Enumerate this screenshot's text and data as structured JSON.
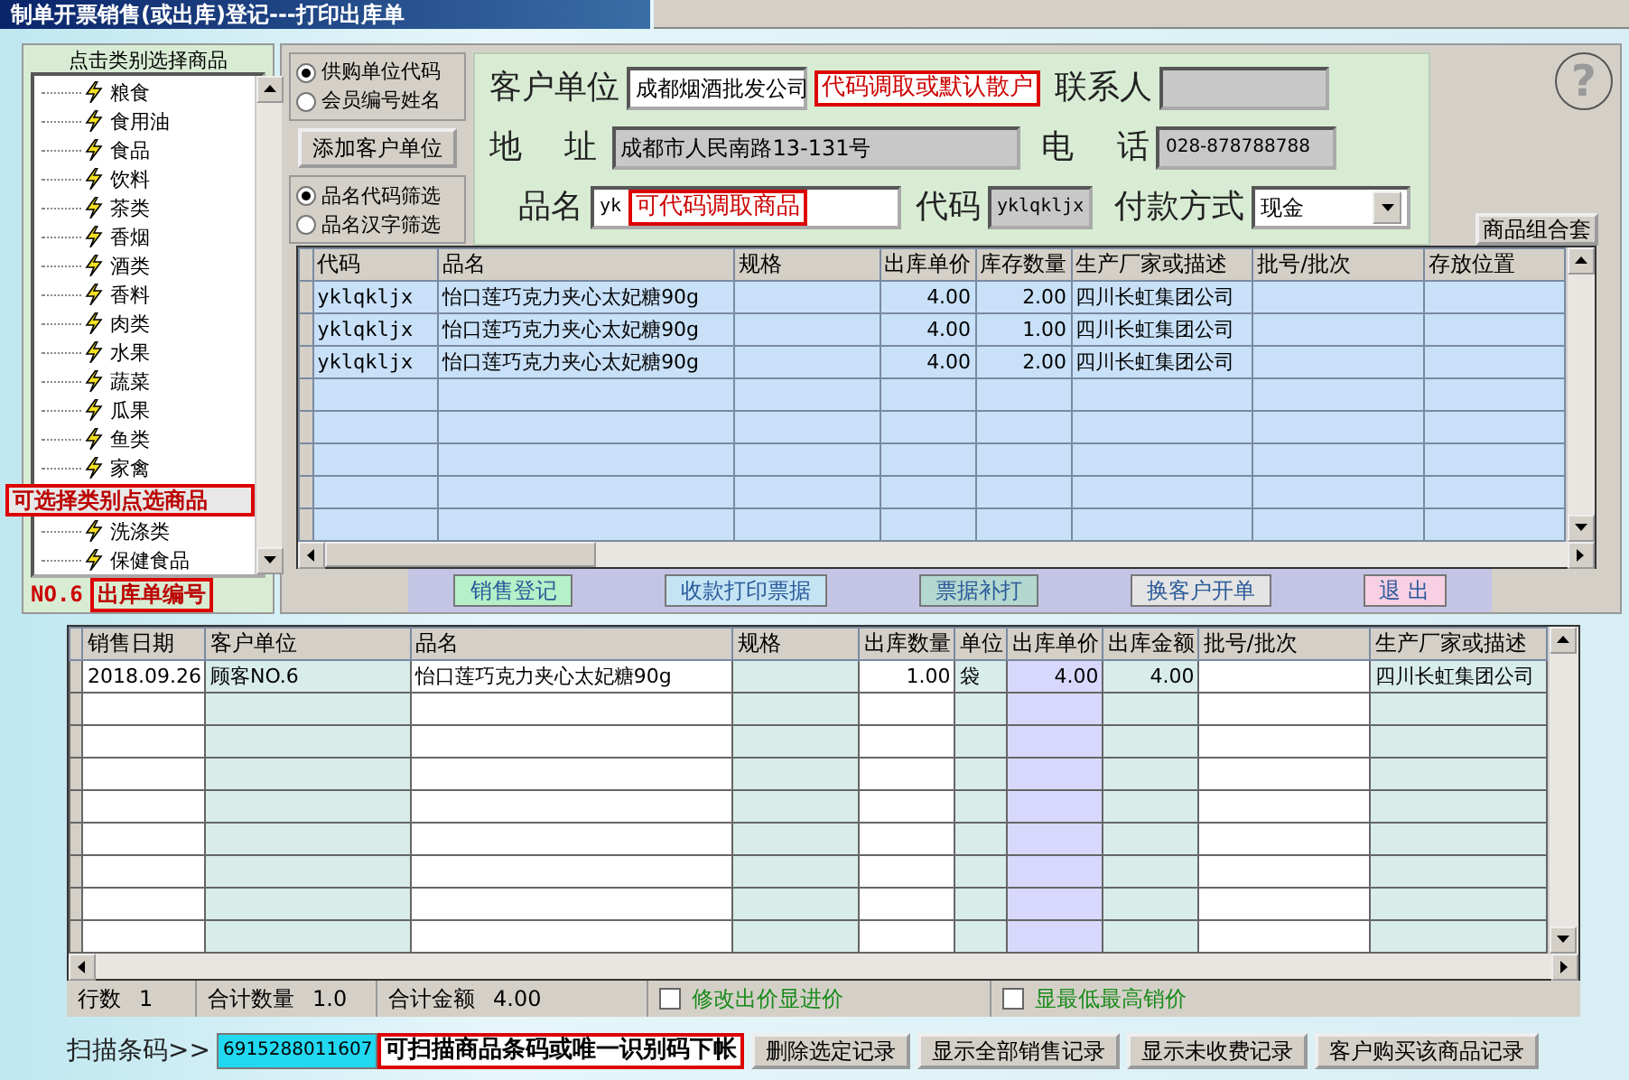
{
  "window": {
    "title": "制单开票销售(或出库)登记---打印出库单"
  },
  "category_panel": {
    "heading": "点击类别选择商品",
    "items": [
      {
        "label": "粮食"
      },
      {
        "label": "食用油"
      },
      {
        "label": "食品"
      },
      {
        "label": "饮料"
      },
      {
        "label": "茶类"
      },
      {
        "label": "香烟"
      },
      {
        "label": "酒类"
      },
      {
        "label": "香料"
      },
      {
        "label": "肉类"
      },
      {
        "label": "水果"
      },
      {
        "label": "蔬菜"
      },
      {
        "label": "瓜果"
      },
      {
        "label": "鱼类"
      },
      {
        "label": "家禽"
      }
    ],
    "overlay_note": "可选择类别点选商品",
    "more_items": [
      {
        "label": "洗涤类"
      },
      {
        "label": "保健食品"
      }
    ],
    "order_no": "NO.6",
    "order_note": "出库单编号"
  },
  "customer_mode": [
    {
      "label": "供购单位代码",
      "selected": true
    },
    {
      "label": "会员编号姓名",
      "selected": false
    }
  ],
  "add_customer_button": "添加客户单位",
  "filter_mode": [
    {
      "label": "品名代码筛选",
      "selected": true
    },
    {
      "label": "品名汉字筛选",
      "selected": false
    }
  ],
  "form": {
    "customer_label": "客户单位",
    "customer_value": "成都烟酒批发公司",
    "customer_note": "代码调取或默认散户",
    "contact_label": "联系人",
    "address_label": "地 址",
    "address_value": "成都市人民南路13-131号",
    "phone_label": "电 话",
    "phone_value": "028-878788788",
    "product_label": "品名",
    "product_value": "yk",
    "product_note": "可代码调取商品",
    "code_label": "代码",
    "code_value": "yklqkljx",
    "payment_label": "付款方式",
    "payment_value": "现金"
  },
  "help_button": "?",
  "combo_button": "商品组合套",
  "product_grid": {
    "columns": [
      "代码",
      "品名",
      "规格",
      "出库单价",
      "库存数量",
      "生产厂家或描述",
      "批号/批次",
      "存放位置"
    ],
    "rows": [
      [
        "yklqkljx",
        "怡口莲巧克力夹心太妃糖90g",
        "",
        "4.00",
        "2.00",
        "四川长虹集团公司",
        "",
        ""
      ],
      [
        "yklqkljx",
        "怡口莲巧克力夹心太妃糖90g",
        "",
        "4.00",
        "1.00",
        "四川长虹集团公司",
        "",
        ""
      ],
      [
        "yklqkljx",
        "怡口莲巧克力夹心太妃糖90g",
        "",
        "4.00",
        "2.00",
        "四川长虹集团公司",
        "",
        ""
      ]
    ]
  },
  "action_buttons": [
    {
      "label": "销售登记",
      "color": "#b4f0c8"
    },
    {
      "label": "收款打印票据",
      "color": "#c4e4f4"
    },
    {
      "label": "票据补打",
      "color": "#b4d8d0"
    },
    {
      "label": "换客户开单",
      "color": "#e4e4e4"
    },
    {
      "label": "退 出",
      "color": "#f8d0e4"
    }
  ],
  "sales_grid": {
    "columns": [
      "销售日期",
      "客户单位",
      "品名",
      "规格",
      "出库数量",
      "单位",
      "出库单价",
      "出库金额",
      "批号/批次",
      "生产厂家或描述"
    ],
    "rows": [
      [
        "2018.09.26",
        "顾客NO.6",
        "怡口莲巧克力夹心太妃糖90g",
        "",
        "1.00",
        "袋",
        "4.00",
        "4.00",
        "",
        "四川长虹集团公司"
      ]
    ]
  },
  "status_bar": {
    "row_count_label": "行数",
    "row_count": "1",
    "total_qty_label": "合计数量",
    "total_qty": "1.0",
    "total_amount_label": "合计金额",
    "total_amount": "4.00",
    "options": [
      {
        "label": "修改出价显进价",
        "checked": false
      },
      {
        "label": "显最低最高销价",
        "checked": false
      }
    ]
  },
  "scan": {
    "label": "扫描条码>>",
    "value": "6915288011607",
    "note": "可扫描商品条码或唯一识别码下帐"
  },
  "bottom_buttons": [
    "删除选定记录",
    "显示全部销售记录",
    "显示未收费记录",
    "客户购买该商品记录"
  ]
}
